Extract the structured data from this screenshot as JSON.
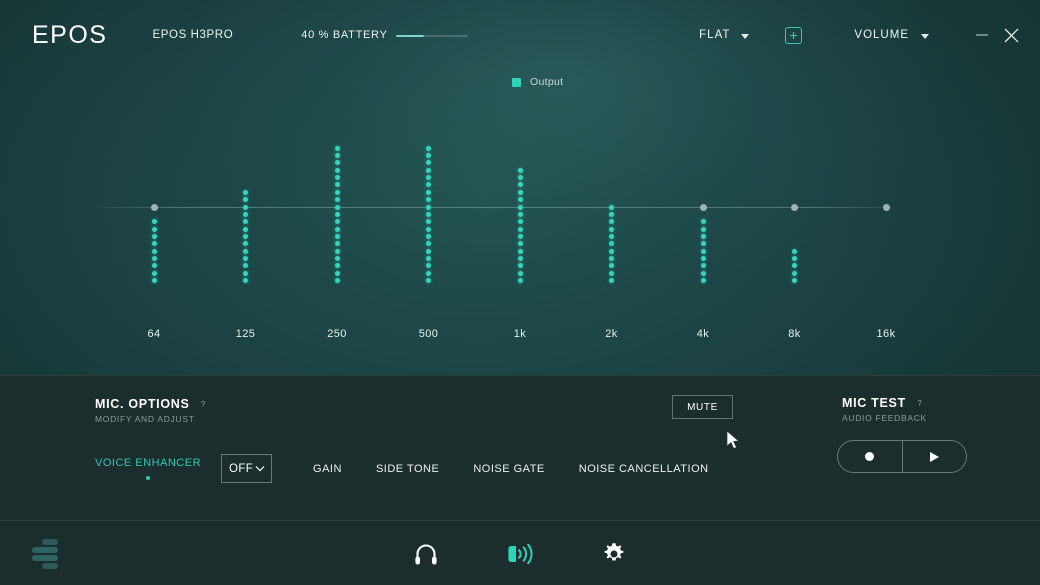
{
  "header": {
    "logo": "EPOS",
    "device_name": "EPOS H3PRO",
    "battery_text": "40 %  BATTERY",
    "battery_percent": 40,
    "preset_label": "FLAT",
    "add_preset_icon": "plus-in-square-icon",
    "volume_label": "VOLUME",
    "minimize_icon": "minimize-icon",
    "close_icon": "close-icon"
  },
  "equalizer": {
    "legend_label": "Output",
    "legend_color": "#2fd3bc"
  },
  "chart_data": {
    "type": "bar",
    "title": "",
    "xlabel": "",
    "ylabel": "",
    "categories": [
      "64",
      "125",
      "250",
      "500",
      "1k",
      "2k",
      "4k",
      "8k",
      "16k"
    ],
    "series": [
      {
        "name": "Output",
        "top_db": [
          -2,
          2,
          8,
          8,
          5,
          0,
          -2,
          -6,
          0
        ],
        "bottom_db": [
          -10,
          -10,
          -10,
          -10,
          -10,
          -10,
          -10,
          -10,
          0
        ]
      }
    ],
    "ylim": [
      -12,
      12
    ],
    "zero_line": true,
    "grid": false,
    "legend_position": "top-center",
    "color": "#33d6c0"
  },
  "mic_options": {
    "title": "MIC. OPTIONS",
    "help": "?",
    "subtitle": "MODIFY AND ADJUST",
    "voice_enhancer_label": "VOICE ENHANCER",
    "voice_enhancer_value": "OFF",
    "tabs": [
      {
        "label": "GAIN"
      },
      {
        "label": "SIDE TONE"
      },
      {
        "label": "NOISE GATE"
      },
      {
        "label": "NOISE CANCELLATION"
      }
    ]
  },
  "mute": {
    "label": "MUTE"
  },
  "mic_test": {
    "title": "MIC TEST",
    "help": "?",
    "subtitle": "AUDIO FEEDBACK",
    "record_icon": "record-icon",
    "play_icon": "play-icon"
  },
  "bottom_nav": {
    "logo_icon": "epos-bars-logo-icon",
    "items": [
      {
        "icon": "headphone-icon",
        "active": false
      },
      {
        "icon": "microphone-sound-icon",
        "active": true
      },
      {
        "icon": "gear-icon",
        "active": false
      }
    ]
  },
  "cursor": {
    "icon": "mouse-pointer-icon"
  }
}
